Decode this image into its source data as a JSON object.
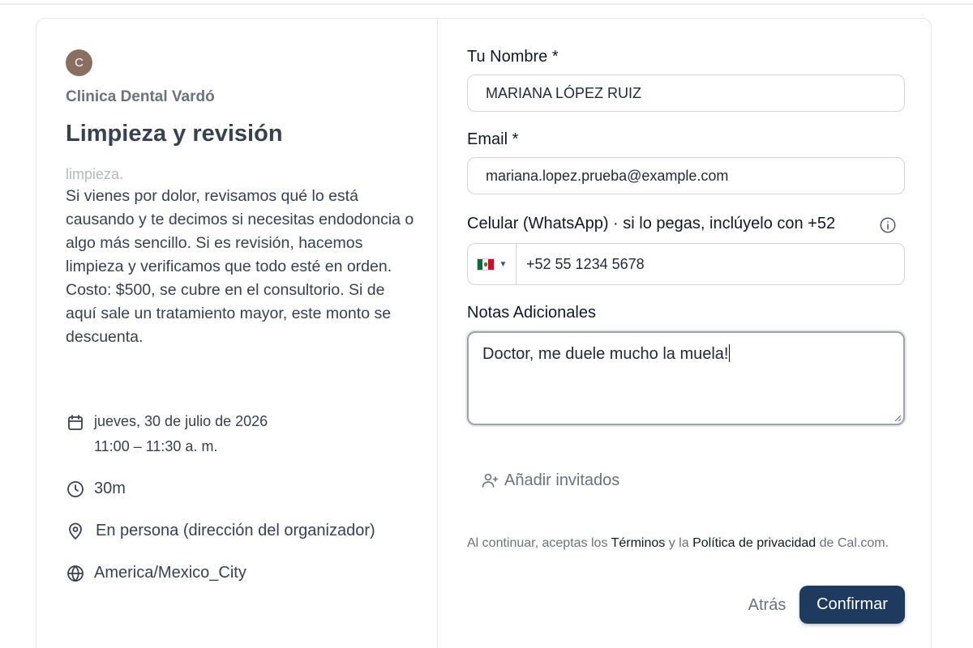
{
  "organizer": {
    "avatar_letter": "C",
    "name": "Clinica Dental Vardó"
  },
  "event": {
    "title": "Limpieza y revisión",
    "description_fade": "limpieza.",
    "description_lines": [
      "Si vienes por dolor, revisamos qué lo está causando y te decimos si necesitas endodoncia o algo más sencillo. Si es revisión, hacemos limpieza y verificamos que todo esté en orden.",
      "Costo: $500, se cubre en el consultorio. Si de aquí sale un tratamiento mayor, este monto se descuenta."
    ],
    "date": "jueves, 30 de julio de 2026",
    "time": "11:00 – 11:30 a. m.",
    "duration": "30m",
    "location": "En persona (dirección del organizador)",
    "timezone": "America/Mexico_City"
  },
  "form": {
    "name_label": "Tu Nombre *",
    "name_value": "MARIANA LÓPEZ RUIZ",
    "email_label": "Email *",
    "email_value": "mariana.lopez.prueba@example.com",
    "phone_label": "Celular (WhatsApp) · si lo pegas, inclúyelo con +52",
    "phone_country": "MX",
    "phone_value": "+52 55 1234 5678",
    "notes_label": "Notas Adicionales",
    "notes_value": "Doctor, me duele mucho la muela!",
    "add_guests_label": "Añadir invitados"
  },
  "terms": {
    "prefix": "Al continuar, aceptas los ",
    "terms_link": "Términos",
    "middle": " y la ",
    "privacy_link": "Política de privacidad",
    "suffix": " de Cal.com."
  },
  "buttons": {
    "back_label": "Atrás",
    "confirm_label": "Confirmar"
  },
  "colors": {
    "confirm_bg": "#1e3a5f",
    "avatar_bg": "#8a6e62"
  },
  "icons": [
    "calendar-icon",
    "clock-icon",
    "map-pin-icon",
    "globe-icon",
    "info-icon",
    "user-plus-icon"
  ]
}
